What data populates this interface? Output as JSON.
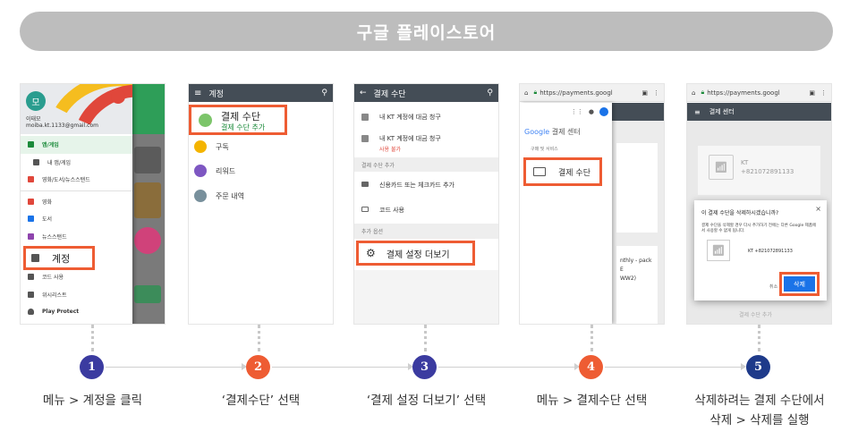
{
  "banner": {
    "title": "구글 플레이스토어"
  },
  "screens": {
    "s1": {
      "avatar_letter": "모",
      "user_name": "이태모",
      "user_email": "moiba.kt.1133@gmail.com",
      "menu": [
        {
          "label": "앱/게임",
          "active": true,
          "color": "#1b8a3a"
        },
        {
          "label": "내 앱/게임",
          "sub": true,
          "color": "#555555"
        },
        {
          "label": "영화/도서/뉴스스탠드",
          "color": "#e0473b"
        },
        {
          "label": "영화",
          "color": "#e0473b"
        },
        {
          "label": "도서",
          "color": "#1a73e8"
        },
        {
          "label": "뉴스스탠드",
          "color": "#8e44ad"
        }
      ],
      "callout_label": "계정",
      "menu_after": [
        {
          "label": "코드 사용",
          "color": "#555555"
        },
        {
          "label": "위시리스트",
          "color": "#555555"
        },
        {
          "label": "Play Protect",
          "color": "#555555"
        }
      ]
    },
    "s2": {
      "header": "계정",
      "callout_title": "결제 수단",
      "callout_sub": "결제 수단 추가",
      "rows": [
        {
          "label": "구독",
          "color": "#f4b400"
        },
        {
          "label": "리워드",
          "color": "#7e57c2"
        },
        {
          "label": "주문 내역",
          "color": "#78909c"
        }
      ]
    },
    "s3": {
      "header": "결제 수단",
      "items": [
        {
          "label": "내 KT 계정에 대금 청구"
        },
        {
          "label": "내 KT 계정에 대금 청구",
          "warn": "사용 불가"
        }
      ],
      "section_add": "결제 수단 추가",
      "add_items": [
        "신용카드 또는 체크카드 추가",
        "코드 사용"
      ],
      "section_more": "추가 옵션",
      "callout_label": "결제 설정 더보기"
    },
    "s4": {
      "url": "https://payments.googl",
      "brand": "Google",
      "title": "결제 센터",
      "small": "구매 및 서비스",
      "callout_label": "결제 수단",
      "card2_text": "nthly - pack\nE\nWW2)"
    },
    "s5": {
      "url": "https://payments.googl",
      "header": "결제 센터",
      "carrier": "KT",
      "number": "+821072891133",
      "dialog_question": "이 결제 수단을 삭제하시겠습니까?",
      "dialog_desc": "결제 수단을 삭제할 경우 다시 추가하기 전에는 다른 Google 제품에서 사용할 수 없게 됩니다.",
      "dialog_number": "KT +821072891133",
      "cancel_label": "취소",
      "delete_label": "삭제",
      "add_link": "결제 수단 추가"
    }
  },
  "steps": [
    {
      "num": "1",
      "color": "#3b3ba0",
      "caption": "메뉴 > 계정을 클릭"
    },
    {
      "num": "2",
      "color": "#ee5c33",
      "caption": "‘결제수단’ 선택"
    },
    {
      "num": "3",
      "color": "#3b3ba0",
      "caption": "‘결제 설정 더보기’ 선택"
    },
    {
      "num": "4",
      "color": "#ee5c33",
      "caption": "메뉴 > 결제수단 선택"
    },
    {
      "num": "5",
      "color": "#1e3a8a",
      "caption_line1": "삭제하려는 결제 수단에서",
      "caption_line2": "삭제 > 삭제를 실행"
    }
  ]
}
